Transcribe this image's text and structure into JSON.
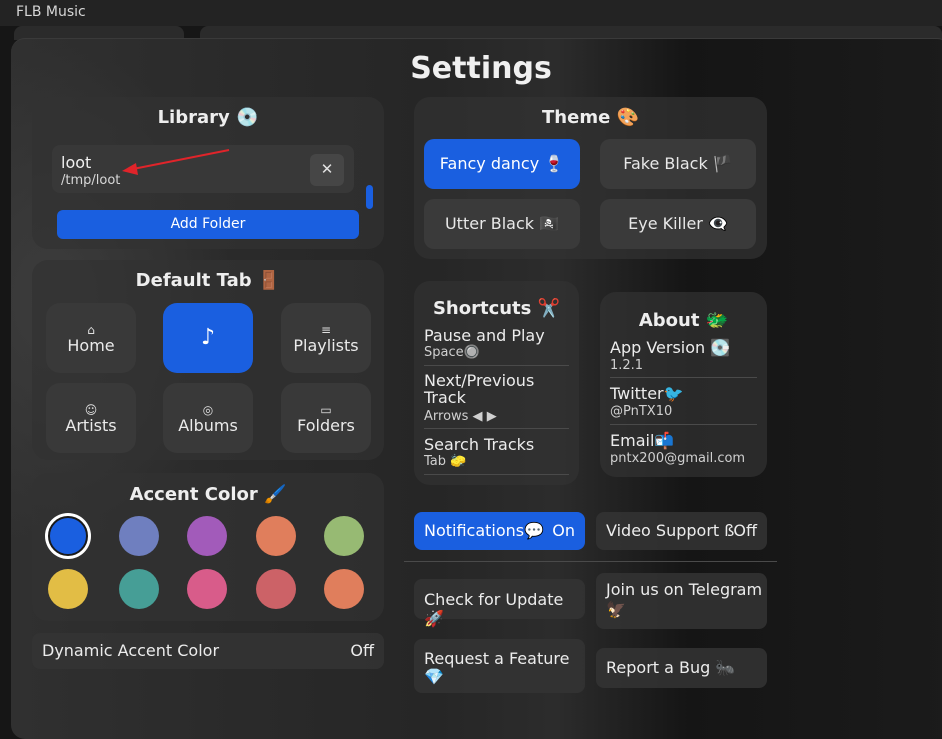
{
  "app_title": "FLB Music",
  "page_title": "Settings",
  "library": {
    "heading": "Library 💿",
    "folder_name": "loot",
    "folder_path": "/tmp/loot",
    "add_folder": "Add Folder",
    "remove_icon": "close-icon"
  },
  "default_tab": {
    "heading": "Default Tab 🚪",
    "tabs": [
      {
        "label": "Home",
        "icon": "⌂"
      },
      {
        "label": "",
        "icon": "♪"
      },
      {
        "label": "Playlists",
        "icon": "≡"
      },
      {
        "label": "Artists",
        "icon": "☺"
      },
      {
        "label": "Albums",
        "icon": "◎"
      },
      {
        "label": "Folders",
        "icon": "▭"
      }
    ],
    "selected_index": 1
  },
  "accent": {
    "heading": "Accent Color 🖌️",
    "colors": [
      "#1a5fe0",
      "#6f7fbf",
      "#a25bba",
      "#e07e5c",
      "#97ba73",
      "#e2bd45",
      "#469e96",
      "#d85c8a",
      "#cc6267",
      "#e07e5c"
    ],
    "selected_index": 0
  },
  "dynamic_accent": {
    "label": "Dynamic Accent Color",
    "value": "Off"
  },
  "theme": {
    "heading": "Theme 🎨",
    "options": [
      "Fancy dancy 🍷",
      "Fake Black 🏴",
      "Utter Black 🏴‍☠️",
      "Eye Killer 👁‍🗨"
    ],
    "selected_index": 0
  },
  "shortcuts": {
    "heading": "Shortcuts ✂️",
    "items": [
      {
        "title": "Pause and Play",
        "key": "Space🔘"
      },
      {
        "title": "Next/Previous Track",
        "key": "Arrows ◀ ▶"
      },
      {
        "title": "Search Tracks",
        "key": "Tab 🧽"
      }
    ]
  },
  "about": {
    "heading": "About 🐲",
    "items": [
      {
        "title": "App Version 💽",
        "value": "1.2.1"
      },
      {
        "title": "Twitter🐦",
        "value": "@PnTX10"
      },
      {
        "title": "Email📬",
        "value": "pntx200@gmail.com"
      }
    ]
  },
  "notifications": {
    "label": "Notifications💬",
    "value": "On"
  },
  "video_support": {
    "label": "Video Support ß",
    "value": "Off"
  },
  "actions": {
    "check_update": "Check for Update 🚀",
    "telegram_line1": "Join us on Telegram",
    "telegram_line2": "🦅",
    "request_line1": "Request a Feature",
    "request_line2": "💎",
    "report_bug": "Report a Bug 🐜"
  },
  "colors": {
    "accent": "#1a5fe0",
    "card": "#323232",
    "arrow": "#e0242a"
  }
}
